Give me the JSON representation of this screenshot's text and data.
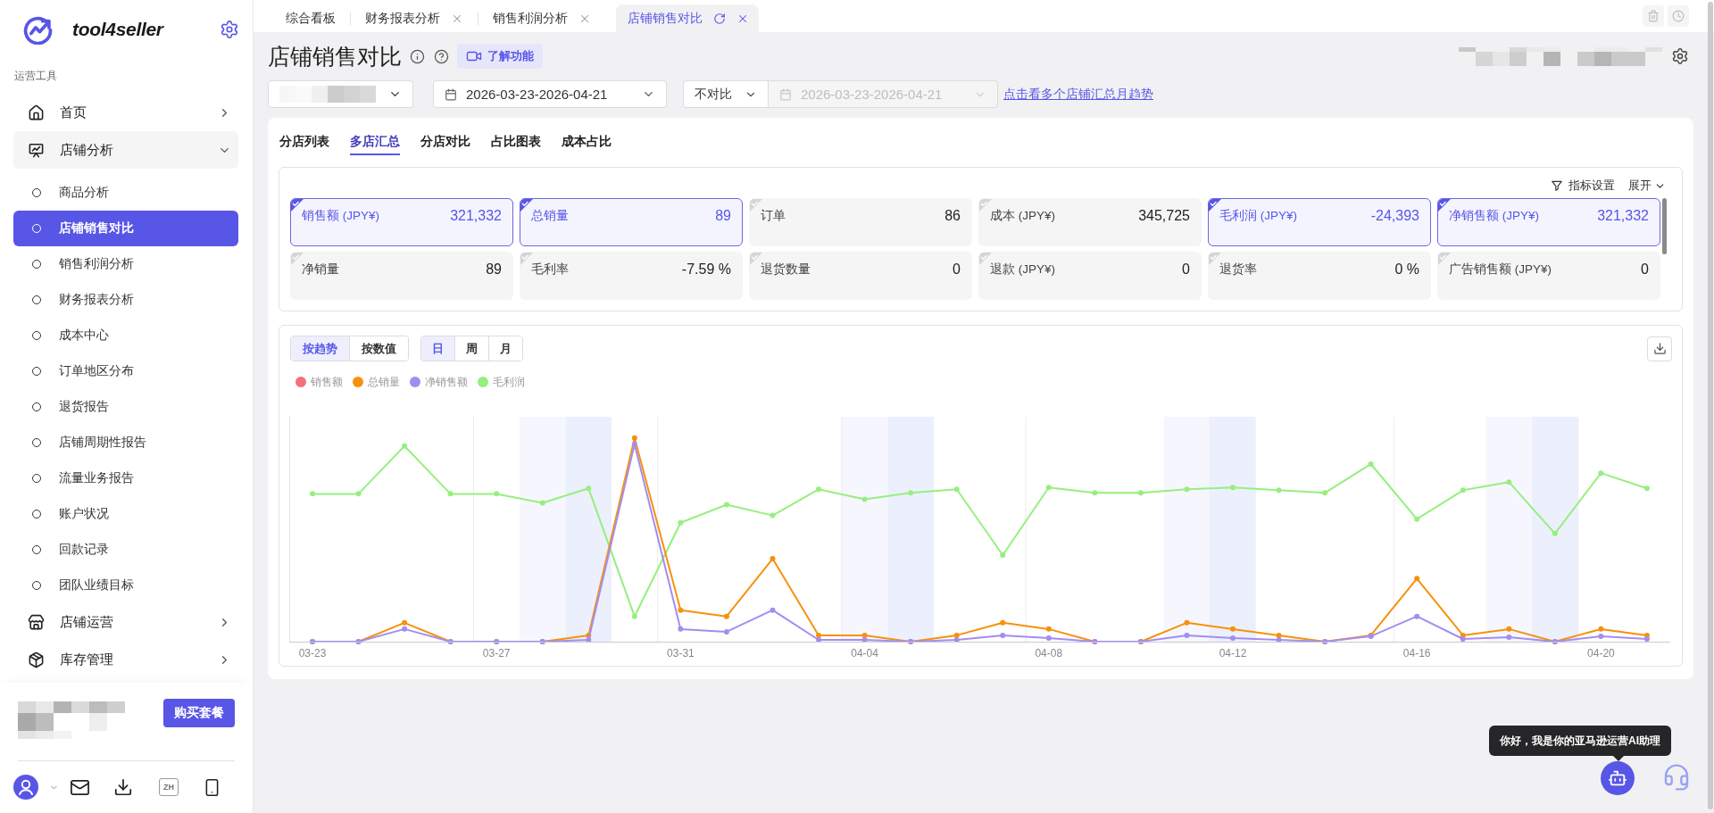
{
  "sidebar": {
    "brand": "tool4seller",
    "section_title": "运营工具",
    "items": [
      {
        "label": "首页",
        "expanded": false
      },
      {
        "label": "店铺分析",
        "expanded": true,
        "children": [
          {
            "label": "商品分析",
            "selected": false
          },
          {
            "label": "店铺销售对比",
            "selected": true
          },
          {
            "label": "销售利润分析",
            "selected": false
          },
          {
            "label": "财务报表分析",
            "selected": false
          },
          {
            "label": "成本中心",
            "selected": false
          },
          {
            "label": "订单地区分布",
            "selected": false
          },
          {
            "label": "退货报告",
            "selected": false
          },
          {
            "label": "店铺周期性报告",
            "selected": false
          },
          {
            "label": "流量业务报告",
            "selected": false
          },
          {
            "label": "账户状况",
            "selected": false
          },
          {
            "label": "回款记录",
            "selected": false
          },
          {
            "label": "团队业绩目标",
            "selected": false
          }
        ]
      },
      {
        "label": "店铺运营",
        "expanded": false
      },
      {
        "label": "库存管理",
        "expanded": false
      }
    ],
    "buy_button": "购买套餐",
    "language_button": "ZH"
  },
  "tabs": [
    {
      "label": "综合看板",
      "selected": false,
      "closable": false
    },
    {
      "label": "财务报表分析",
      "selected": false,
      "closable": true
    },
    {
      "label": "销售利润分析",
      "selected": false,
      "closable": true
    },
    {
      "label": "店铺销售对比",
      "selected": true,
      "closable": true
    }
  ],
  "header": {
    "title": "店铺销售对比",
    "learn_button": "了解功能"
  },
  "filters": {
    "date_range": "2026-03-23-2026-04-21",
    "compare": "不对比",
    "compare_range": {
      "value": "2026-03-23-2026-04-21",
      "disabled": true
    },
    "link": "点击看多个店铺汇总月趋势"
  },
  "sub_tabs": [
    {
      "label": "分店列表",
      "selected": false
    },
    {
      "label": "多店汇总",
      "selected": true
    },
    {
      "label": "分店对比",
      "selected": false
    },
    {
      "label": "占比图表",
      "selected": false
    },
    {
      "label": "成本占比",
      "selected": false
    }
  ],
  "metrics": {
    "settings_button": "指标设置",
    "expand_button": "展开",
    "items": [
      {
        "label": "销售额 (JPY¥)",
        "value": "321,332",
        "selected": true
      },
      {
        "label": "总销量",
        "value": "89",
        "selected": true
      },
      {
        "label": "订单",
        "value": "86",
        "selected": false
      },
      {
        "label": "成本 (JPY¥)",
        "value": "345,725",
        "selected": false
      },
      {
        "label": "毛利润 (JPY¥)",
        "value": "-24,393",
        "selected": true
      },
      {
        "label": "净销售额 (JPY¥)",
        "value": "321,332",
        "selected": true
      },
      {
        "label": "净销量",
        "value": "89",
        "selected": false
      },
      {
        "label": "毛利率",
        "value": "-7.59 %",
        "selected": false
      },
      {
        "label": "退货数量",
        "value": "0",
        "selected": false
      },
      {
        "label": "退款 (JPY¥)",
        "value": "0",
        "selected": false
      },
      {
        "label": "退货率",
        "value": "0 %",
        "selected": false
      },
      {
        "label": "广告销售额 (JPY¥)",
        "value": "0",
        "selected": false
      }
    ]
  },
  "chart": {
    "view_modes": [
      {
        "label": "按趋势",
        "selected": true
      },
      {
        "label": "按数值",
        "selected": false
      }
    ],
    "granularity": [
      {
        "label": "日",
        "selected": true
      },
      {
        "label": "周",
        "selected": false
      },
      {
        "label": "月",
        "selected": false
      }
    ],
    "legend": [
      {
        "label": "销售额",
        "color": "#f4707b"
      },
      {
        "label": "总销量",
        "color": "#f7910c"
      },
      {
        "label": "净销售额",
        "color": "#a38df0"
      },
      {
        "label": "毛利润",
        "color": "#96ef7f"
      }
    ],
    "x_labels": [
      "03-23",
      "03-27",
      "03-31",
      "04-04",
      "04-08",
      "04-12",
      "04-16",
      "04-20"
    ]
  },
  "assistant": {
    "greeting": "你好，我是你的亚马逊运营AI助理"
  }
}
